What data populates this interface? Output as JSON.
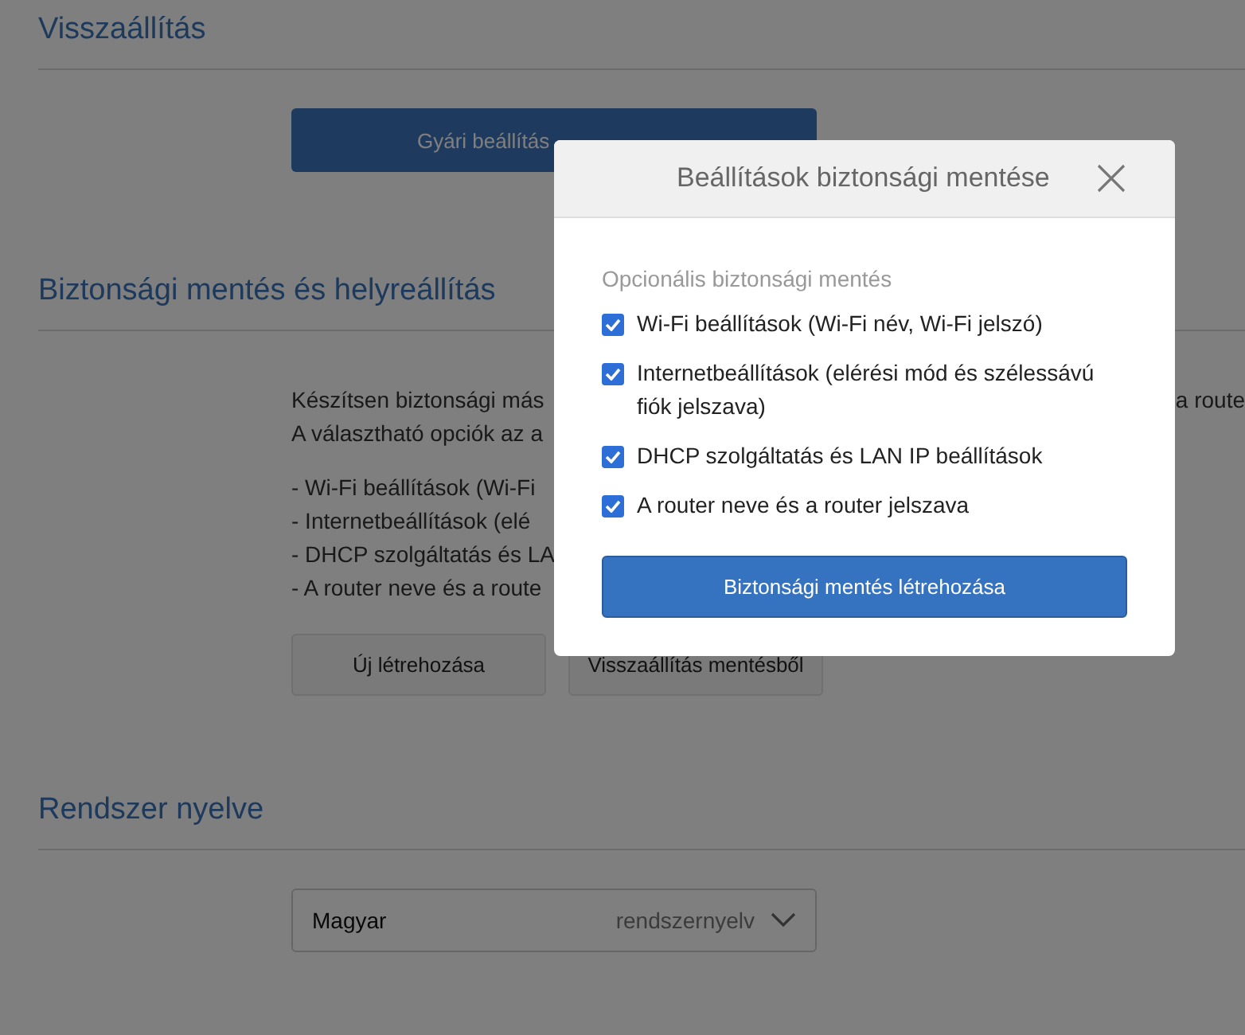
{
  "sections": [
    {
      "title": "Visszaállítás",
      "kind": "reset",
      "button": "Gyári beállítás"
    },
    {
      "title": "Biztonsági mentés és helyreállítás",
      "kind": "backup",
      "paragraph_left": "Készítsen biztonsági más",
      "paragraph_right": "a route",
      "paragraph_line2": "A választható opciók az a",
      "list": [
        "- Wi-Fi beállítások (Wi-Fi",
        "- Internetbeállítások (elé",
        "- DHCP szolgáltatás és LA",
        "- A router neve és a route"
      ],
      "buttons": [
        "Új létrehozása",
        "Visszaállítás mentésből"
      ]
    },
    {
      "title": "Rendszer nyelve",
      "kind": "language",
      "select": {
        "value": "Magyar",
        "hint": "rendszernyelv"
      }
    }
  ],
  "dialog": {
    "title": "Beállítások biztonsági mentése",
    "subtitle": "Opcionális biztonsági mentés",
    "options": [
      {
        "label": "Wi-Fi beállítások (Wi-Fi név, Wi-Fi jelszó)",
        "checked": true
      },
      {
        "label": "Internetbeállítások (elérési mód és szélessávú fiók jelszava)",
        "checked": true
      },
      {
        "label": "DHCP szolgáltatás és LAN IP beállítások",
        "checked": true
      },
      {
        "label": "A router neve és a router jelszava",
        "checked": true
      }
    ],
    "button": "Biztonsági mentés létrehozása"
  }
}
